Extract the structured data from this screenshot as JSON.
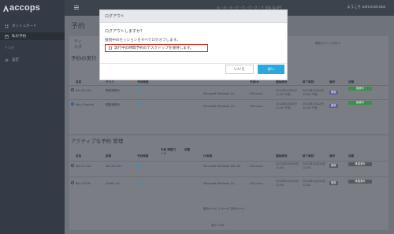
{
  "app": {
    "logo_text": "accops"
  },
  "sidebar": {
    "items": [
      {
        "label": "ダッシュボード"
      },
      {
        "label": "私の予約"
      },
      {
        "label": "設定"
      }
    ],
    "section_label": "その他"
  },
  "topbar": {
    "center_text": "キ・キ・キ・ケ・ケ・ケ・ケ・ケ 日本 (jp JP)",
    "user_text": "ようこそ administrator"
  },
  "main": {
    "page_title": "予約",
    "section1_title": "予約の実行",
    "section1_partial": "ディ\nルダ",
    "section1_top_right": "現在のマシン予約 ▾",
    "section1_headers": [
      "名前",
      "デスク",
      "予約時間",
      "予約ID",
      "開始時刻",
      "終了時刻",
      "操作",
      "状態"
    ],
    "section1_rows": [
      {
        "name": "Win-TS-002",
        "desk": "開発事務所",
        "os": "Microsoft Windows 10...",
        "host": "ESX-xxxx",
        "start": "2022年10月2日 11:00 午前",
        "end": "2022年10月2日 12:00 午後",
        "action": "削除",
        "status": "接続中"
      },
      {
        "name": "Win-Channel",
        "desk": "開発事務所",
        "os": "Microsoft Windows 10...",
        "host": "ESX-xxxx",
        "start": "2022年10月2日 11:00 午前",
        "end": "2022年10月2日 12:00 午後",
        "action": "削除",
        "status": "接続中"
      }
    ],
    "section2_title": "アクティブな予約 管理",
    "section2_headers": [
      "名前",
      "説明",
      "予約時間",
      "予約 時間コード",
      "状態",
      "IP説明",
      "開始時刻",
      "終了時刻",
      "操作",
      "状態"
    ],
    "section2_rows": [
      {
        "name": "Win-TS-001",
        "desk": "Win-TS-001",
        "os": "Microsoft Windows Win 64",
        "host": "ESX-xxxx",
        "start": "2022年10月16日 11:00",
        "end": "2022年10月16日 12:00",
        "action": "削除",
        "status": "承認済み"
      },
      {
        "name": "Win-SOUM",
        "desk": "Unifier AV",
        "os": "Microsoft Windows 10...",
        "host": "ESX-xxxx",
        "start": "2022年10月16日 11:00",
        "end": "2022年10月16日 12:00",
        "action": "削除",
        "status": "承認済み"
      }
    ],
    "pager_text": "前のページ 1 ページ 次のページ",
    "footer_text": "表示 10件"
  },
  "modal": {
    "title": "ログアウト",
    "question": "ログアウトしますか？",
    "description": "接続中のセッションをすべてログオフします。",
    "checkbox_label": "実行中の時間予約のデスクトップを保持します。",
    "cancel_label": "いいえ",
    "confirm_label": "はい"
  }
}
